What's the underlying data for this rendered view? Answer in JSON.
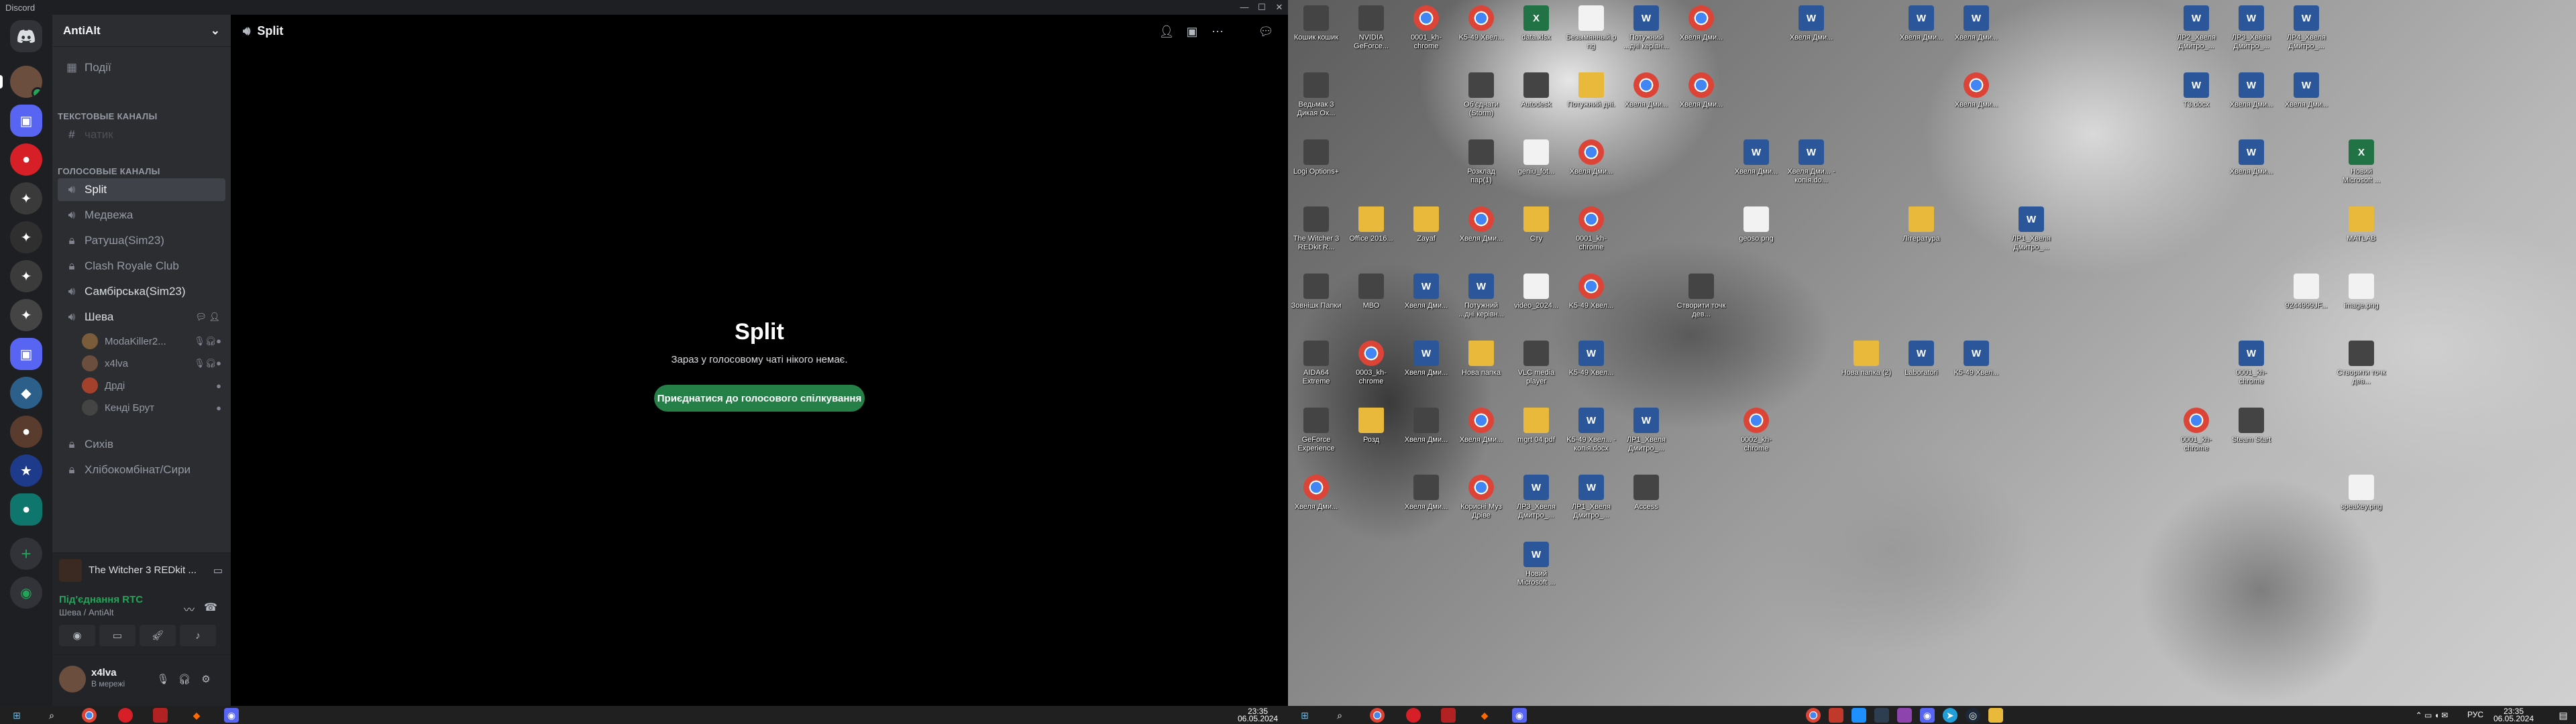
{
  "window": {
    "app_title": "Discord",
    "btn_min": "—",
    "btn_max": "☐",
    "btn_close": "✕"
  },
  "server": {
    "name": "AntiAlt",
    "chevron": "⌄"
  },
  "sidebar": {
    "events_label": "Події",
    "text_category": "ТЕКСТОВЫЕ КАНАЛЫ",
    "text_channel": "чатик",
    "voice_category": "ГОЛОСОВЫЕ КАНАЛЫ",
    "voice_channels": [
      "Split",
      "Медвежа",
      "Ратуша(Sim23)",
      "Clash Royale Club",
      "Самбірська(Sim23)",
      "Шева"
    ],
    "members": [
      "ModaKiller2...",
      "x4lva",
      "Дрді",
      "Кенді Брут"
    ],
    "after_channels": [
      "Сихів",
      "Хлібокомбінат/Сири"
    ]
  },
  "activity": {
    "game": "The Witcher 3 REDkit ..."
  },
  "voice_panel": {
    "status": "Під'єднання RTC",
    "location": "Шева / AntiAlt"
  },
  "user": {
    "name": "x4lva",
    "status": "В мережі"
  },
  "main": {
    "channel": "Split",
    "call_title": "Split",
    "call_subtitle": "Зараз у голосовому чаті нікого немає.",
    "join_button": "Приєднатися до голосового спілкування"
  },
  "left_taskbar": {
    "time": "23:35",
    "date": "06.05.2024"
  },
  "desktop_icons": [
    {
      "label": "Кошик кошик",
      "kind": "app"
    },
    {
      "label": "NVIDIA GeForce...",
      "kind": "app"
    },
    {
      "label": "0001_kh-chrome",
      "kind": "chrome"
    },
    {
      "label": "K5-49 Хвел...",
      "kind": "chrome"
    },
    {
      "label": "data.xlsx",
      "kind": "excel"
    },
    {
      "label": "Безымянный.png",
      "kind": "img"
    },
    {
      "label": "Потужний ...дні керівн...",
      "kind": "word"
    },
    {
      "label": "Хвеля Дми...",
      "kind": "chrome"
    },
    {
      "label": "Хвеля Дми...",
      "kind": "word"
    },
    {
      "label": "Хвеля Дми...",
      "kind": "word"
    },
    {
      "label": "Хвеля Дми...",
      "kind": "word"
    },
    {
      "label": "ЛР2_Хвеля Дмитро_...",
      "kind": "word"
    },
    {
      "label": "ЛР3_Хвеля Дмитро_...",
      "kind": "word"
    },
    {
      "label": "ЛР4_Хвеля Дмитро_...",
      "kind": "word"
    },
    {
      "label": "Ведьмак 3 Дикая Ох...",
      "kind": "app"
    },
    {
      "label": "Об'єднати (Storm)",
      "kind": "app"
    },
    {
      "label": "Autodesk",
      "kind": "app"
    },
    {
      "label": "Потужний дні.",
      "kind": "folder"
    },
    {
      "label": "Хвеля Дми...",
      "kind": "chrome"
    },
    {
      "label": "Хвеля Дми...",
      "kind": "chrome"
    },
    {
      "label": "Хвеля Дми...",
      "kind": "chrome"
    },
    {
      "label": "T3.docx",
      "kind": "word"
    },
    {
      "label": "Хвеля Дми...",
      "kind": "word"
    },
    {
      "label": "Хвеля Дми...",
      "kind": "word"
    },
    {
      "label": "Logi Options+",
      "kind": "app"
    },
    {
      "label": "Розклад пар(1)",
      "kind": "app"
    },
    {
      "label": "geniu_fot...",
      "kind": "img"
    },
    {
      "label": "Хвеля Дми...",
      "kind": "chrome"
    },
    {
      "label": "Хвеля Дми...",
      "kind": "word"
    },
    {
      "label": "Хвеля Дми... - копія.do...",
      "kind": "word"
    },
    {
      "label": "Хвеля Дми...",
      "kind": "word"
    },
    {
      "label": "Новий Microsoft ...",
      "kind": "excel"
    },
    {
      "label": "The Witcher 3 REDkit R...",
      "kind": "app"
    },
    {
      "label": "Office 2016...",
      "kind": "folder"
    },
    {
      "label": "Zayaf",
      "kind": "folder"
    },
    {
      "label": "Сту",
      "kind": "folder"
    },
    {
      "label": "Хвеля Дми...",
      "kind": "chrome"
    },
    {
      "label": "0001_kh-chrome",
      "kind": "chrome"
    },
    {
      "label": "geoso.png",
      "kind": "img"
    },
    {
      "label": "Література",
      "kind": "folder"
    },
    {
      "label": "ЛР1_Хвеля Дмитро_...",
      "kind": "word"
    },
    {
      "label": "MATLAB",
      "kind": "folder"
    },
    {
      "label": "Зовнішк Папки",
      "kind": "app"
    },
    {
      "label": "МВО",
      "kind": "app"
    },
    {
      "label": "Хвеля Дми...",
      "kind": "word"
    },
    {
      "label": "Потужний ...дні керівн...",
      "kind": "word"
    },
    {
      "label": "video_2024...",
      "kind": "img"
    },
    {
      "label": "K5-49 Хвел...",
      "kind": "chrome"
    },
    {
      "label": "Створити точк дев...",
      "kind": "app"
    },
    {
      "label": "9244999JF...",
      "kind": "img"
    },
    {
      "label": "image.png",
      "kind": "img"
    },
    {
      "label": "AIDA64 Extreme",
      "kind": "app"
    },
    {
      "label": "0003_kh-chrome",
      "kind": "chrome"
    },
    {
      "label": "Хвеля Дми...",
      "kind": "word"
    },
    {
      "label": "Нова папка",
      "kind": "folder"
    },
    {
      "label": "VLC media player",
      "kind": "app"
    },
    {
      "label": "K5-49 Хвел...",
      "kind": "word"
    },
    {
      "label": "Нова папка (2)",
      "kind": "folder"
    },
    {
      "label": "Laboratori",
      "kind": "word"
    },
    {
      "label": "K5-49 Хвел...",
      "kind": "word"
    },
    {
      "label": "0001_kh-chrome",
      "kind": "word"
    },
    {
      "label": "Створити точк дев...",
      "kind": "app"
    },
    {
      "label": "GeForce Experience",
      "kind": "app"
    },
    {
      "label": "Розд",
      "kind": "folder"
    },
    {
      "label": "Хвеля Дми...",
      "kind": "app"
    },
    {
      "label": "Хвеля Дми...",
      "kind": "chrome"
    },
    {
      "label": "mgrt 04.pdf",
      "kind": "folder"
    },
    {
      "label": "K5-49 Хвел... - копія.docx",
      "kind": "word"
    },
    {
      "label": "ЛР1_Хвеля Дмитро_...",
      "kind": "word"
    },
    {
      "label": "0002_kh-chrome",
      "kind": "chrome"
    },
    {
      "label": "0001_kh-chrome",
      "kind": "chrome"
    },
    {
      "label": "Steam Start",
      "kind": "app"
    },
    {
      "label": "Хвеля Дми...",
      "kind": "chrome"
    },
    {
      "label": "Хвеля Дми...",
      "kind": "app"
    },
    {
      "label": "Корисні Муз Дріве",
      "kind": "chrome"
    },
    {
      "label": "ЛР3_Хвеля Дмитро_...",
      "kind": "word"
    },
    {
      "label": "ЛР1_Хвеля Дмитро_...",
      "kind": "word"
    },
    {
      "label": "Access",
      "kind": "app"
    },
    {
      "label": "speakey.png",
      "kind": "img"
    },
    {
      "label": "Новий Microsoft ...",
      "kind": "word"
    }
  ],
  "right_taskbar": {
    "lang": "РУС",
    "time": "23:35",
    "date": "06.05.2024"
  }
}
